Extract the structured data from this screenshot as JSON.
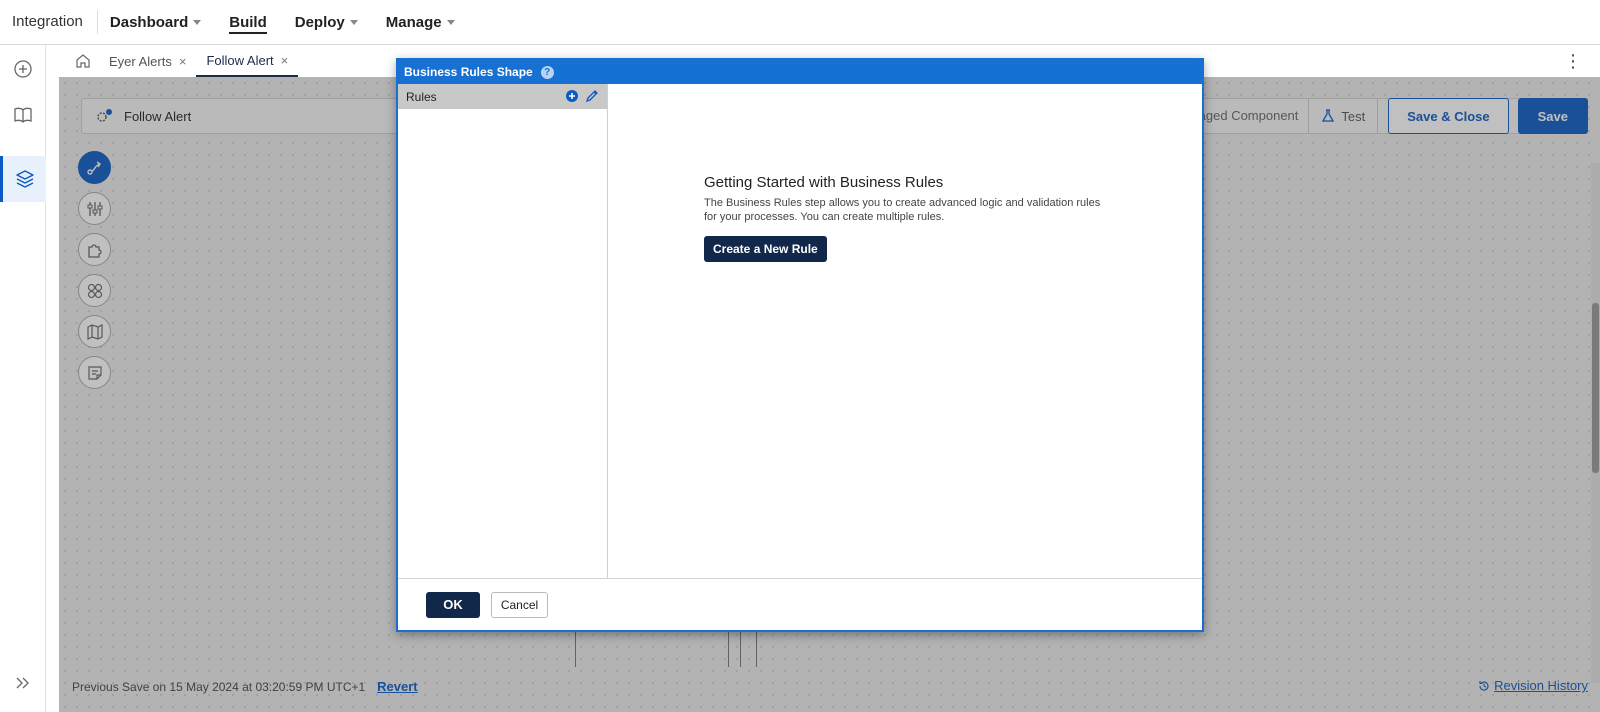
{
  "topnav": {
    "brand": "Integration",
    "items": [
      {
        "label": "Dashboard",
        "dropdown": true
      },
      {
        "label": "Build",
        "dropdown": false
      },
      {
        "label": "Deploy",
        "dropdown": true
      },
      {
        "label": "Manage",
        "dropdown": true
      }
    ]
  },
  "tabs": {
    "items": [
      {
        "label": "Eyer Alerts"
      },
      {
        "label": "Follow Alert"
      }
    ],
    "close_glyph": "×",
    "menu_glyph": "⋮"
  },
  "process": {
    "name": "Follow Alert",
    "packaged_component": "ckaged Component",
    "test_label": "Test",
    "save_close_label": "Save & Close",
    "save_label": "Save"
  },
  "status": {
    "previous_save": "Previous Save on 15 May 2024 at 03:20:59 PM UTC+1",
    "revert": "Revert",
    "revision_history": "Revision History"
  },
  "modal": {
    "title": "Business Rules Shape",
    "help": "?",
    "rules_header": "Rules",
    "heading": "Getting Started with Business Rules",
    "description": "The Business Rules step allows you to create advanced logic and validation rules for your processes. You can create multiple rules.",
    "create_button": "Create a New Rule",
    "ok": "OK",
    "cancel": "Cancel"
  },
  "colors": {
    "primary": "#0a5bc4",
    "modal_title_bar": "#1771d2",
    "dark_button": "#12284b"
  }
}
